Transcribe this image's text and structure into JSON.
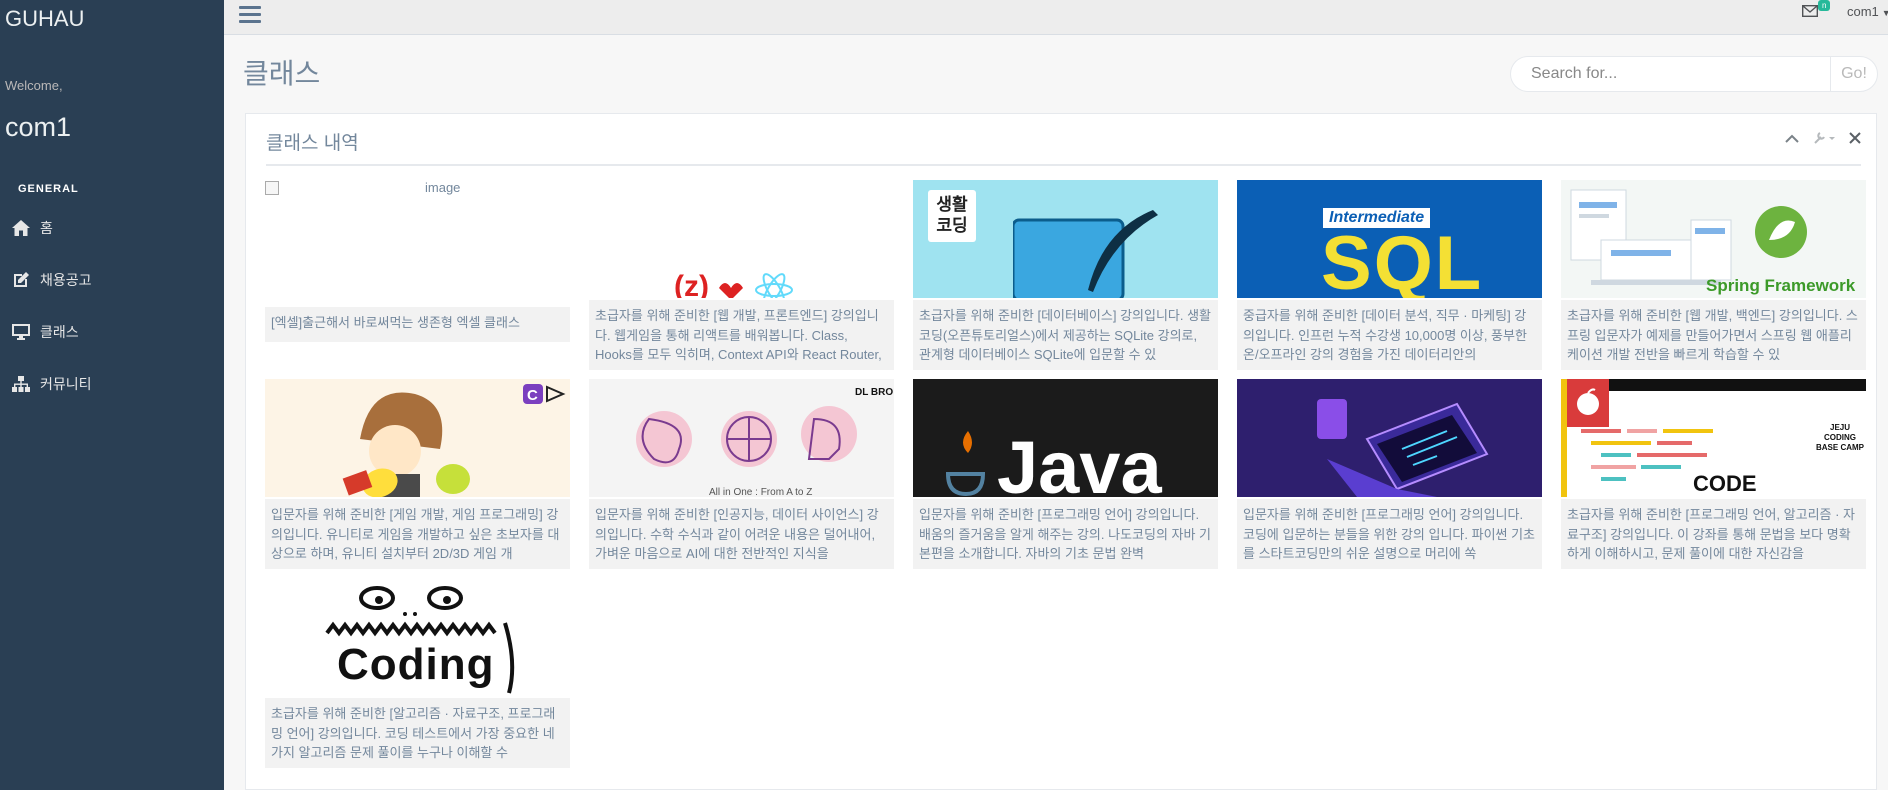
{
  "sidebar": {
    "brand": "GUHAU",
    "welcome": "Welcome,",
    "username": "com1",
    "section_title": "GENERAL",
    "items": [
      {
        "label": "홈",
        "icon": "home-icon"
      },
      {
        "label": "채용공고",
        "icon": "edit-icon"
      },
      {
        "label": "클래스",
        "icon": "desktop-icon"
      },
      {
        "label": "커뮤니티",
        "icon": "sitemap-icon"
      }
    ]
  },
  "topnav": {
    "mail_badge": "n",
    "user": "com1"
  },
  "page": {
    "title": "클래스",
    "search_placeholder": "Search for...",
    "search_button": "Go!"
  },
  "panel": {
    "title": "클래스 내역",
    "tools": [
      "chevron-up-icon",
      "wrench-icon",
      "close-icon"
    ]
  },
  "cards": [
    {
      "thumb": "broken-image",
      "alt": "image",
      "desc": "[엑셀]출근해서 바로써먹는 생존형 엑셀 클래스"
    },
    {
      "thumb": "web-frontend",
      "desc": "초급자를 위해 준비한 [웹 개발, 프론트엔드] 강의입니다. 웹게임을 통해 리액트를 배워봅니다. Class, Hooks를 모두 익히며, Context API와 React Router,"
    },
    {
      "thumb": "saenghwal-coding",
      "thumb_text": "생활 코딩",
      "desc": "초급자를 위해 준비한 [데이터베이스] 강의입니다. 생활코딩(오픈튜토리얼스)에서 제공하는 SQLite 강의로, 관계형 데이터베이스 SQLite에 입문할 수 있"
    },
    {
      "thumb": "sql",
      "thumb_badge": "Intermediate",
      "thumb_text": "SQL",
      "desc": "중급자를 위해 준비한 [데이터 분석, 직무 · 마케팅] 강의입니다. 인프런 누적 수강생 10,000명 이상, 풍부한 온/오프라인 강의 경험을 가진 데이터리안의"
    },
    {
      "thumb": "spring",
      "thumb_text": "Spring Framework",
      "desc": "초급자를 위해 준비한 [웹 개발, 백엔드] 강의입니다. 스프링 입문자가 예제를 만들어가면서 스프링 웹 애플리케이션 개발 전반을 빠르게 학습할 수 있"
    },
    {
      "thumb": "game",
      "desc": "입문자를 위해 준비한 [게임 개발, 게임 프로그래밍] 강의입니다. 유니티로 게임을 개발하고 싶은 초보자를 대상으로 하며, 유니티 설치부터 2D/3D 게임 개"
    },
    {
      "thumb": "ai",
      "thumb_text": "DL BRO",
      "thumb_caption": "All in One : From A to Z",
      "desc": "입문자를 위해 준비한 [인공지능, 데이터 사이언스] 강의입니다. 수학 수식과 같이 어려운 내용은 덜어내어, 가벼운 마음으로 AI에 대한 전반적인 지식을"
    },
    {
      "thumb": "java",
      "thumb_text": "Java",
      "desc": "입문자를 위해 준비한 [프로그래밍 언어] 강의입니다. 배움의 즐거움을 알게 해주는 강의. 나도코딩의 자바 기본편을 소개합니다. 자바의 기초 문법 완벽"
    },
    {
      "thumb": "python",
      "desc": "입문자를 위해 준비한 [프로그래밍 언어] 강의입니다. 코딩에 입문하는 분들을 위한 강의 입니다. 파이썬 기초를 스타트코딩만의 쉬운 설명으로 머리에 쏙"
    },
    {
      "thumb": "code-festival",
      "thumb_text": "CODE FESTIVAL",
      "thumb_sub": [
        "JEJU",
        "CODING",
        "BASE CAMP"
      ],
      "desc": "초급자를 위해 준비한 [프로그래밍 언어, 알고리즘 · 자료구조] 강의입니다. 이 강좌를 통해 문법을 보다 명확하게 이해하시고, 문제 풀이에 대한 자신감을"
    },
    {
      "thumb": "coding",
      "thumb_text": "Coding",
      "desc": "초급자를 위해 준비한 [알고리즘 · 자료구조, 프로그래밍 언어] 강의입니다. 코딩 테스트에서 가장 중요한 네 가지 알고리즘 문제 풀이를 누구나 이해할 수"
    }
  ],
  "colors": {
    "sidebar_bg": "#2a3f54",
    "body_bg": "#f7f7f7",
    "text": "#73879c",
    "sql_bg": "#0b5fb5",
    "java_bg": "#1b1b1b",
    "python_bg": "#2e1f6e"
  }
}
